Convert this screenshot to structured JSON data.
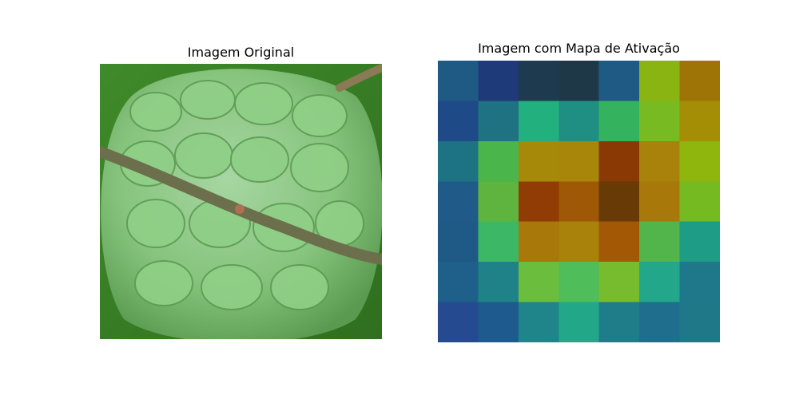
{
  "figure": {
    "left_title": "Imagem Original",
    "right_title": "Imagem com Mapa de Ativação"
  },
  "photo": {
    "subject": "custard apple (fruit) with branch",
    "colors": {
      "fruit_light": "#9fd29a",
      "fruit_mid": "#7fbf73",
      "fruit_dark": "#5e9b55",
      "leaf_bg": "#3f8a2a",
      "branch": "#6a6a4a"
    }
  },
  "activation_map": {
    "rows": 7,
    "cols": 7,
    "cells": [
      [
        "#1f5a85",
        "#1f3a78",
        "#1e3a4f",
        "#1f3848",
        "#1f5a85",
        "#8ab411",
        "#9e7406"
      ],
      [
        "#1f4a88",
        "#1e7282",
        "#22b07e",
        "#1f8f84",
        "#35b25e",
        "#78ba22",
        "#a48e06"
      ],
      [
        "#1e7383",
        "#4ab54b",
        "#a7890a",
        "#a7860a",
        "#8a3804",
        "#a8820a",
        "#8fb60d"
      ],
      [
        "#1f5a89",
        "#5eb43e",
        "#923c05",
        "#9f5806",
        "#673a06",
        "#a8790a",
        "#76ba22"
      ],
      [
        "#1f5a87",
        "#3cb766",
        "#a8780a",
        "#a8820a",
        "#a35806",
        "#52b54b",
        "#1f9c86"
      ],
      [
        "#1f608a",
        "#1f8289",
        "#6bbd3e",
        "#4fbd5a",
        "#77bc2f",
        "#22a78a",
        "#1f7889"
      ],
      [
        "#264a90",
        "#1f5a8e",
        "#1f858a",
        "#23a789",
        "#1f7d8a",
        "#1f6e8e",
        "#1f7888"
      ]
    ]
  }
}
